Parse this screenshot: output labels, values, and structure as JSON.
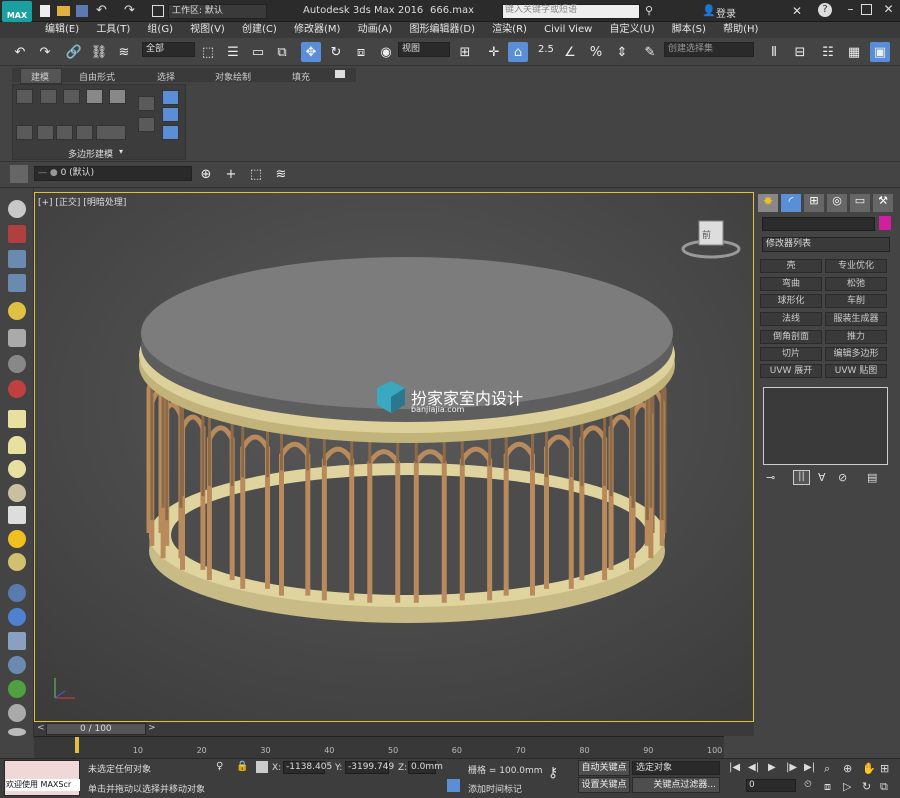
{
  "titlebar": {
    "workspace_label": "工作区: 默认",
    "app_title": "Autodesk 3ds Max 2016",
    "file_name": "666.max",
    "search_placeholder": "键入关键字或短语",
    "login_label": "登录"
  },
  "menu": [
    "编辑(E)",
    "工具(T)",
    "组(G)",
    "视图(V)",
    "创建(C)",
    "修改器(M)",
    "动画(A)",
    "图形编辑器(D)",
    "渲染(R)",
    "Civil View",
    "自定义(U)",
    "脚本(S)",
    "帮助(H)"
  ],
  "toolbar": {
    "filter_value": "全部",
    "ref_coord_value": "视图",
    "snap_angle": "2.5",
    "named_selection_placeholder": "创建选择集"
  },
  "ribbon": {
    "tabs": [
      "建模",
      "自由形式",
      "选择",
      "对象绘制",
      "填充"
    ],
    "panel_label": "多边形建模"
  },
  "layerbar": {
    "layer_value": "0 (默认)"
  },
  "viewport": {
    "label": "[+] [正交] [明暗处理]",
    "watermark_title": "扮家家室内设计",
    "watermark_url": "banjiajia.com"
  },
  "command_panel": {
    "modifier_list_label": "修改器列表",
    "modifier_buttons": [
      "壳",
      "专业优化",
      "弯曲",
      "松弛",
      "球形化",
      "车削",
      "法线",
      "服装生成器",
      "倒角剖面",
      "推力",
      "切片",
      "编辑多边形",
      "UVW 展开",
      "UVW 贴图"
    ],
    "object_color": "#d020a0"
  },
  "timeline": {
    "slider_label": "0 / 100",
    "ticks": [
      "10",
      "20",
      "30",
      "40",
      "50",
      "60",
      "70",
      "80",
      "90",
      "100"
    ]
  },
  "status": {
    "maxscript_label": "欢迎使用 MAXScr",
    "selection_status": "未选定任何对象",
    "prompt": "单击并拖动以选择并移动对象",
    "x_label": "X:",
    "x_value": "-1138.405",
    "y_label": "Y:",
    "y_value": "-3199.749",
    "z_label": "Z:",
    "z_value": "0.0mm",
    "grid_label": "栅格 = 100.0mm",
    "add_time_tag": "添加时间标记",
    "auto_key": "自动关键点",
    "set_key": "设置关键点",
    "key_filter_value": "选定对象",
    "key_filters": "关键点过滤器...",
    "frame_value": "0"
  },
  "colors": {
    "accent": "#e0c040",
    "brand_teal": "#1aa0a0"
  }
}
